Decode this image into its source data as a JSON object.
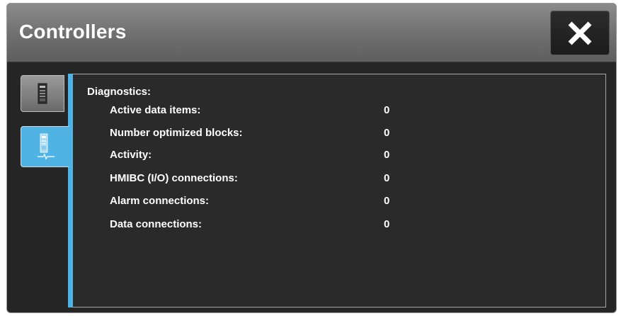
{
  "window": {
    "title": "Controllers",
    "close_icon": "close-x-icon"
  },
  "tabs": [
    {
      "name": "controllers",
      "icon": "controller-device-icon",
      "selected": false
    },
    {
      "name": "diagnostics",
      "icon": "controller-diagnostics-icon",
      "selected": true
    }
  ],
  "diagnostics": {
    "heading": "Diagnostics:",
    "rows": [
      {
        "label": "Active data items:",
        "value": "0"
      },
      {
        "label": "Number optimized blocks:",
        "value": "0"
      },
      {
        "label": "Activity:",
        "value": "0"
      },
      {
        "label": "HMIBC (I/O) connections:",
        "value": "0"
      },
      {
        "label": "Alarm connections:",
        "value": "0"
      },
      {
        "label": "Data connections:",
        "value": "0"
      }
    ]
  },
  "colors": {
    "accent": "#4fb3e4",
    "background": "#2a2a2a",
    "titlebar": "#6f6f6f",
    "text": "#ffffff"
  }
}
